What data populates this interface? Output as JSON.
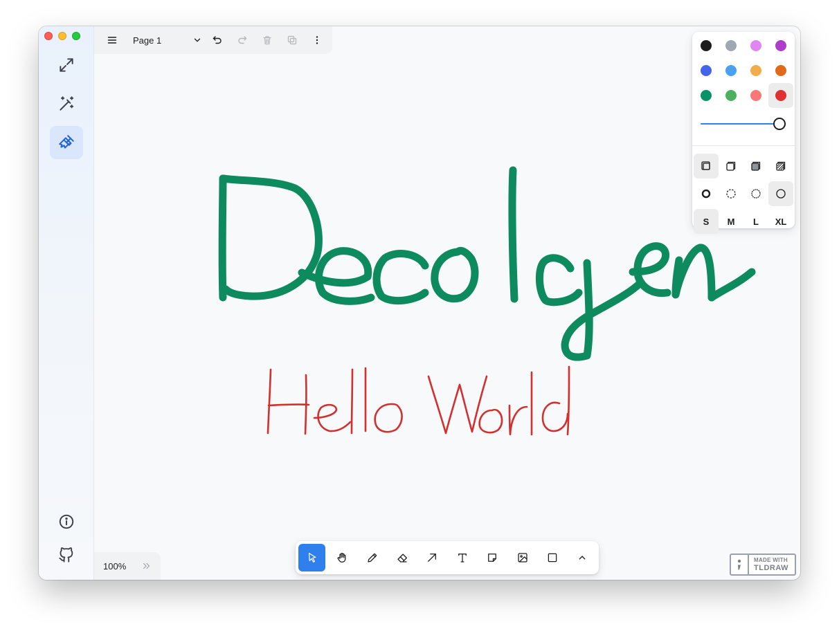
{
  "window": {
    "controls": [
      "close",
      "minimize",
      "zoom"
    ]
  },
  "sidebar": {
    "items": [
      {
        "icon": "expand-icon",
        "active": false
      },
      {
        "icon": "magic-wand-icon",
        "active": false
      },
      {
        "icon": "paintbrush-icon",
        "active": true
      },
      {
        "icon": "info-icon",
        "active": false
      },
      {
        "icon": "github-icon",
        "active": false
      }
    ]
  },
  "menu": {
    "page_name": "Page 1",
    "icons": [
      "hamburger-menu-icon",
      "chevron-down-icon",
      "undo-icon",
      "redo-icon",
      "trash-icon",
      "duplicate-icon",
      "more-vertical-icon"
    ]
  },
  "canvas": {
    "drawings": [
      {
        "text": "Decolgen",
        "color": "#0e8a5f"
      },
      {
        "text": "Hello World",
        "color": "#e03131"
      }
    ]
  },
  "style_panel": {
    "colors": [
      {
        "name": "black",
        "hex": "#1d1d1d",
        "selected": false
      },
      {
        "name": "grey",
        "hex": "#9fa8b2",
        "selected": false
      },
      {
        "name": "light-violet",
        "hex": "#e085f4",
        "selected": false
      },
      {
        "name": "violet",
        "hex": "#ae3ec9",
        "selected": false
      },
      {
        "name": "blue",
        "hex": "#4465e9",
        "selected": false
      },
      {
        "name": "light-blue",
        "hex": "#4ba1f1",
        "selected": false
      },
      {
        "name": "yellow",
        "hex": "#f1ac4b",
        "selected": false
      },
      {
        "name": "orange",
        "hex": "#e16919",
        "selected": false
      },
      {
        "name": "green",
        "hex": "#099268",
        "selected": false
      },
      {
        "name": "light-green",
        "hex": "#4cb05e",
        "selected": false
      },
      {
        "name": "light-red",
        "hex": "#f87777",
        "selected": false
      },
      {
        "name": "red",
        "hex": "#e03131",
        "selected": true
      }
    ],
    "opacity": 1.0,
    "fills": [
      {
        "name": "fill-none-icon",
        "selected": true
      },
      {
        "name": "fill-semi-icon",
        "selected": false
      },
      {
        "name": "fill-solid-icon",
        "selected": false
      },
      {
        "name": "fill-pattern-icon",
        "selected": false
      }
    ],
    "dashes": [
      {
        "name": "dash-draw-icon",
        "selected": false
      },
      {
        "name": "dash-dashed-icon",
        "selected": false
      },
      {
        "name": "dash-dotted-icon",
        "selected": false
      },
      {
        "name": "dash-solid-icon",
        "selected": true
      }
    ],
    "sizes": [
      {
        "label": "S",
        "selected": true
      },
      {
        "label": "M",
        "selected": false
      },
      {
        "label": "L",
        "selected": false
      },
      {
        "label": "XL",
        "selected": false
      }
    ]
  },
  "toolbar": {
    "tools": [
      {
        "name": "select-icon",
        "selected": true
      },
      {
        "name": "hand-icon",
        "selected": false
      },
      {
        "name": "draw-icon",
        "selected": false
      },
      {
        "name": "eraser-icon",
        "selected": false
      },
      {
        "name": "arrow-icon",
        "selected": false
      },
      {
        "name": "text-icon",
        "selected": false
      },
      {
        "name": "note-icon",
        "selected": false
      },
      {
        "name": "image-icon",
        "selected": false
      },
      {
        "name": "rectangle-icon",
        "selected": false
      },
      {
        "name": "chevron-up-icon",
        "selected": false
      }
    ]
  },
  "zoom": {
    "level": "100%"
  },
  "watermark": {
    "line1": "MADE WITH",
    "line2": "TLDRAW"
  },
  "colors": {
    "accent": "#2f80ed",
    "icon": "#1d1d1d",
    "sidebar_active_icon": "#2563d9"
  }
}
